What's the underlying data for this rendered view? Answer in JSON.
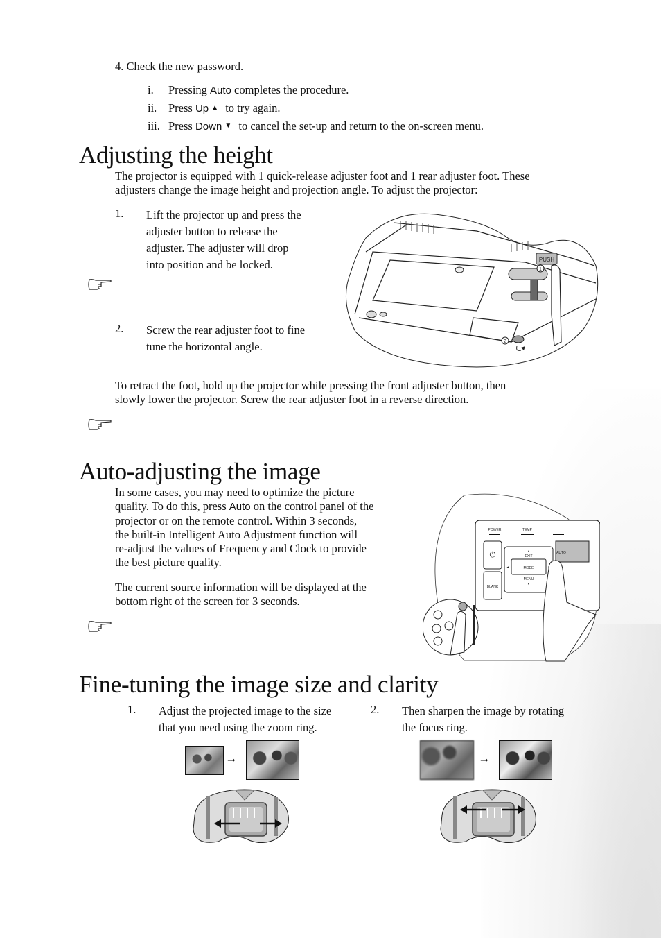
{
  "password_steps": {
    "step4": "4. Check the new password.",
    "substeps": [
      {
        "marker": "i.",
        "pre": "Pressing ",
        "key": "Auto",
        "post": " completes the procedure.",
        "icon": ""
      },
      {
        "marker": "ii.",
        "pre": "Press ",
        "key": "Up",
        "post": " to try again.",
        "icon": "up-triangle-icon",
        "glyph": "▲"
      },
      {
        "marker": "iii.",
        "pre": "Press ",
        "key": "Down",
        "post": " to cancel the set-up and return to the on-screen menu.",
        "icon": "down-triangle-icon",
        "glyph": "▼"
      }
    ]
  },
  "height_section": {
    "title": "Adjusting the height",
    "intro_line1": "The projector is equipped with 1 quick-release adjuster foot and 1 rear adjuster foot. These",
    "intro_line2": "adjusters change the image height and projection angle. To adjust the projector:",
    "steps": [
      {
        "num": "1.",
        "lines": [
          "Lift the projector up and press the",
          "adjuster button to release the",
          "adjuster. The adjuster will drop",
          "into position and be locked."
        ]
      },
      {
        "num": "2.",
        "lines": [
          "Screw the rear adjuster foot to fine",
          "tune the horizontal angle."
        ]
      }
    ],
    "retract_line1": "To retract the foot, hold up the projector while pressing the front adjuster button, then",
    "retract_line2": "slowly lower the projector. Screw the rear adjuster foot in a reverse direction.",
    "illustration": {
      "push_label": "PUSH",
      "callout_1": "1",
      "callout_2": "2"
    }
  },
  "auto_section": {
    "title": "Auto-adjusting the image",
    "para1": {
      "lines": [
        {
          "pre": "In some cases, you may need to optimize the picture",
          "key": "",
          "post": ""
        },
        {
          "pre": "quality. To do this, press ",
          "key": "Auto",
          "post": " on the control panel of the"
        },
        {
          "pre": "projector or on the remote control. Within 3 seconds,",
          "key": "",
          "post": ""
        },
        {
          "pre": "the built-in Intelligent Auto Adjustment function will",
          "key": "",
          "post": ""
        },
        {
          "pre": "re-adjust the values of Frequency and Clock to provide",
          "key": "",
          "post": ""
        },
        {
          "pre": "the best picture quality.",
          "key": "",
          "post": ""
        }
      ]
    },
    "para2_line1": "The current source information will be displayed at the",
    "para2_line2": "bottom right of the screen for 3 seconds.",
    "panel": {
      "power": "POWER",
      "temp": "TEMP",
      "auto": "AUTO",
      "exit": "EXIT",
      "mode": "MODE",
      "menu": "MENU",
      "blank": "BLANK",
      "up_arrow": "▲",
      "down_arrow": "▼",
      "left_arrow": "◄",
      "right_arrow": "►",
      "power_glyph": "⏻"
    }
  },
  "finetune_section": {
    "title": "Fine-tuning the image size and clarity",
    "steps": [
      {
        "num": "1.",
        "lines": [
          "Adjust the projected image to the size",
          "that you need using the zoom ring."
        ]
      },
      {
        "num": "2.",
        "lines": [
          "Then sharpen the image by rotating",
          "the focus ring."
        ]
      }
    ],
    "arrow_glyph": "➞"
  }
}
